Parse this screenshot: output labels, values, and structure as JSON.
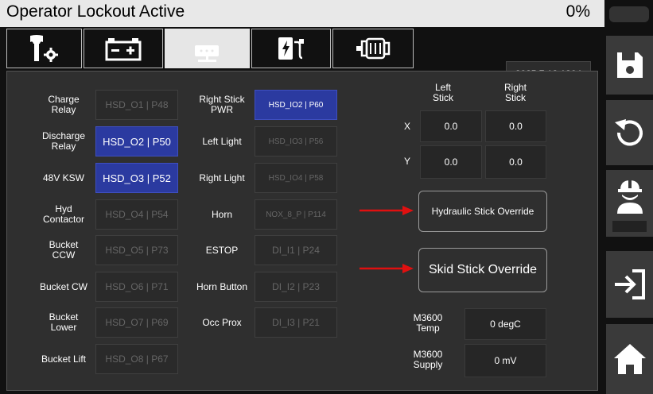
{
  "header": {
    "title": "Operator Lockout Active",
    "percent": "0%"
  },
  "tabs": [
    {
      "icon": "wrench-gear-icon"
    },
    {
      "icon": "battery-icon"
    },
    {
      "icon": "network-icon",
      "active": true
    },
    {
      "icon": "charger-icon"
    },
    {
      "icon": "motor-icon"
    }
  ],
  "datetime": "2025.7.18.1304",
  "outputs": [
    {
      "label": "Charge\nRelay",
      "value": "HSD_O1 | P48",
      "active": false
    },
    {
      "label": "Discharge\nRelay",
      "value": "HSD_O2 | P50",
      "active": true
    },
    {
      "label": "48V KSW",
      "value": "HSD_O3 | P52",
      "active": true
    },
    {
      "label": "Hyd\nContactor",
      "value": "HSD_O4 | P54",
      "active": false
    },
    {
      "label": "Bucket\nCCW",
      "value": "HSD_O5 | P73",
      "active": false
    },
    {
      "label": "Bucket CW",
      "value": "HSD_O6 | P71",
      "active": false
    },
    {
      "label": "Bucket\nLower",
      "value": "HSD_O7 | P69",
      "active": false
    },
    {
      "label": "Bucket Lift",
      "value": "HSD_O8 | P67",
      "active": false
    }
  ],
  "io": [
    {
      "label": "Right Stick\nPWR",
      "value": "HSD_IO2 | P60",
      "active": true
    },
    {
      "label": "Left Light",
      "value": "HSD_IO3 | P56",
      "active": false
    },
    {
      "label": "Right Light",
      "value": "HSD_IO4 | P58",
      "active": false
    },
    {
      "label": "Horn",
      "value": "NOX_8_P | P114",
      "active": false
    },
    {
      "label": "ESTOP",
      "value": "DI_I1 | P24",
      "active": false
    },
    {
      "label": "Horn Button",
      "value": "DI_I2 | P23",
      "active": false
    },
    {
      "label": "Occ Prox",
      "value": "DI_I3 | P21",
      "active": false
    }
  ],
  "sticks": {
    "left_label": "Left\nStick",
    "right_label": "Right\nStick",
    "x_label": "X",
    "y_label": "Y",
    "left_x": "0.0",
    "right_x": "0.0",
    "left_y": "0.0",
    "right_y": "0.0"
  },
  "overrides": {
    "hydraulic": "Hydraulic Stick Override",
    "skid": "Skid Stick Override"
  },
  "m3600": {
    "temp_label": "M3600\nTemp",
    "temp_value": "0 degC",
    "supply_label": "M3600\nSupply",
    "supply_value": "0 mV"
  },
  "sidebar": [
    {
      "icon": "save-icon"
    },
    {
      "icon": "refresh-icon"
    },
    {
      "icon": "operator-icon"
    },
    {
      "icon": "logout-icon"
    },
    {
      "icon": "home-icon"
    }
  ],
  "colors": {
    "active": "#2b3aa0",
    "panel": "#2f2f2f",
    "arrow": "#e01010"
  }
}
